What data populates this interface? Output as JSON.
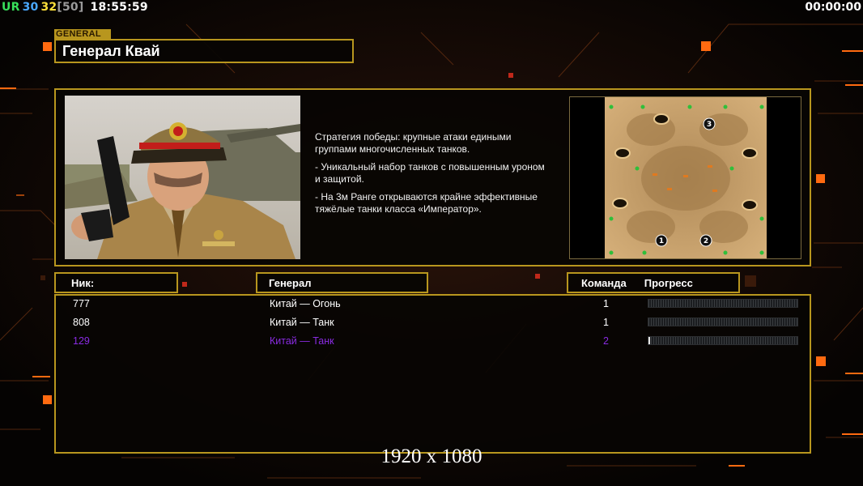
{
  "hud": {
    "ur": "UR",
    "n1": "30",
    "n2": "32",
    "bracket": "[50]",
    "clock": "18:55:59",
    "timer": "00:00:00",
    "colors": {
      "ur": "#38e05a",
      "n1": "#4aa8ff",
      "n2": "#ffe03a",
      "bracket": "#9a9a9a"
    }
  },
  "general": {
    "tag": "GENERAL",
    "name": "Генерал Квай",
    "portrait_icon": "general-portrait-image"
  },
  "description": [
    "Стратегия победы: крупные атаки едиными\n группами многочисленных танков.",
    "- Уникальный набор танков с повышенным уроном\n и защитой.",
    "- На 3м Ранге открываются крайне эффективные\n тяжёлые танки класса «Император»."
  ],
  "map": {
    "icon": "desert-minimap-image",
    "start_labels": [
      "1",
      "2",
      "3"
    ]
  },
  "columns": {
    "nick": "Ник:",
    "general": "Генерал",
    "team": "Команда",
    "progress": "Прогресс"
  },
  "players": [
    {
      "nick": "777",
      "general": "Китай — Огонь",
      "team": "1",
      "progress": 0,
      "color": "#ffffff"
    },
    {
      "nick": "808",
      "general": "Китай — Танк",
      "team": "1",
      "progress": 0,
      "color": "#ffffff"
    },
    {
      "nick": "129",
      "general": "Китай — Танк",
      "team": "2",
      "progress": 0.01,
      "color": "#8a2be2"
    }
  ],
  "resolution": "1920 x 1080",
  "colors": {
    "frame": "#b8961e",
    "accent_orange": "#ff7a1a"
  }
}
